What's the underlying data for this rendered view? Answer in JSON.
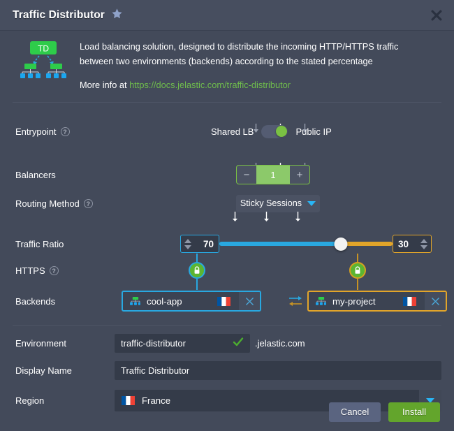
{
  "header": {
    "title": "Traffic Distributor",
    "star_icon": "star-icon",
    "close_icon": "close-icon"
  },
  "intro": {
    "app_icon_label": "TD",
    "description": "Load balancing solution, designed to distribute the incoming HTTP/HTTPS traffic between two environments (backends) according to the stated percentage",
    "more_info_prefix": "More info at",
    "doc_url": "https://docs.jelastic.com/traffic-distributor"
  },
  "entrypoint": {
    "label": "Entrypoint",
    "help_icon": "help-icon",
    "option_left": "Shared LB",
    "option_right": "Public IP",
    "toggle_state": "right"
  },
  "balancers": {
    "label": "Balancers",
    "minus_label": "−",
    "value": "1",
    "plus_label": "+"
  },
  "routing": {
    "label": "Routing Method",
    "help_icon": "help-icon",
    "selected": "Sticky Sessions"
  },
  "traffic_ratio": {
    "label": "Traffic Ratio",
    "left_value": "70",
    "right_value": "30"
  },
  "https": {
    "label": "HTTPS",
    "help_icon": "help-icon",
    "left_lock_icon": "lock-icon",
    "right_lock_icon": "lock-icon"
  },
  "backends": {
    "label": "Backends",
    "left_name": "cool-app",
    "right_name": "my-project",
    "swap_icon": "swap-arrows-icon",
    "remove_icon": "close-icon",
    "flag_icon": "france-flag-icon"
  },
  "environment": {
    "label": "Environment",
    "value": "traffic-distributor",
    "placeholder": "env name",
    "valid_icon": "check-icon",
    "domain_suffix": ".jelastic.com"
  },
  "display_name": {
    "label": "Display Name",
    "value": "Traffic Distributor",
    "placeholder": "display name"
  },
  "region": {
    "label": "Region",
    "selected": "France",
    "flag_icon": "france-flag-icon",
    "caret_icon": "chevron-down-icon"
  },
  "footer": {
    "cancel_label": "Cancel",
    "install_label": "Install"
  },
  "colors": {
    "accent_green": "#63a52c",
    "accent_blue": "#29a8e0",
    "accent_gold": "#e2a52a",
    "panel_bg": "#434a5a",
    "header_bg": "#474e5f",
    "input_bg": "#343b49"
  }
}
